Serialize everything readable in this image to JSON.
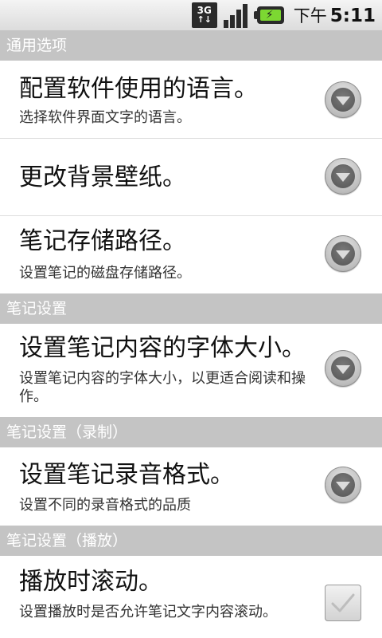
{
  "status_bar": {
    "network_label": "3G",
    "network_arrows": "↑↓",
    "ampm": "下午",
    "time": "5:11",
    "battery_accent": "#7cd832",
    "icons": [
      "3g-icon",
      "signal-icon",
      "battery-charging-icon"
    ]
  },
  "sections": [
    {
      "header": "通用选项",
      "items": [
        {
          "title": "配置软件使用的语言。",
          "summary": "选择软件界面文字的语言。",
          "widget": "dropdown"
        },
        {
          "title": "更改背景壁纸。",
          "summary": "",
          "widget": "dropdown"
        },
        {
          "title": "笔记存储路径。",
          "summary": "设置笔记的磁盘存储路径。",
          "widget": "dropdown"
        }
      ]
    },
    {
      "header": "笔记设置",
      "items": [
        {
          "title": "设置笔记内容的字体大小。",
          "summary": "设置笔记内容的字体大小，以更适合阅读和操作。",
          "widget": "dropdown"
        }
      ]
    },
    {
      "header": "笔记设置（录制）",
      "items": [
        {
          "title": "设置笔记录音格式。",
          "summary": "设置不同的录音格式的品质",
          "widget": "dropdown"
        }
      ]
    },
    {
      "header": "笔记设置（播放）",
      "items": [
        {
          "title": "播放时滚动。",
          "summary": "设置播放时是否允许笔记文字内容滚动。",
          "widget": "checkbox",
          "checked": false
        }
      ]
    }
  ],
  "colors": {
    "section_header_bg": "#c4c4c4",
    "section_header_text": "#ffffff"
  }
}
